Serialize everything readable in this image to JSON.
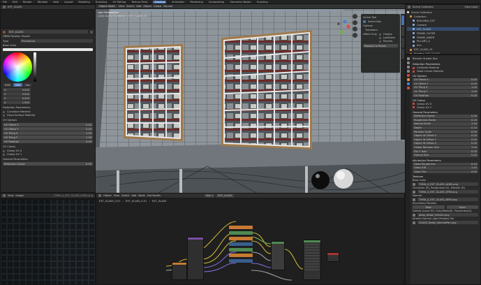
{
  "menubar": {
    "items": [
      "File",
      "Edit",
      "Render",
      "Window",
      "Help",
      "Layout",
      "Modeling",
      "Sculpting",
      "UV Editing",
      "Texture Paint",
      "Shading",
      "Animation",
      "Rendering",
      "Compositing",
      "Geometry Nodes",
      "Scripting"
    ]
  },
  "left_top": {
    "item": "EXT_GLASS"
  },
  "material": {
    "slot_name": "EXT_GLASS",
    "shader": "HBSN Parallax Shader",
    "type_label": "Type",
    "type_value": "Procedural",
    "color_label": "Base Color",
    "color_modes": [
      "RGB",
      "HSV",
      "Hex"
    ],
    "hsv": [
      {
        "k": "H",
        "v": "0.000"
      },
      {
        "k": "S",
        "v": "0.000"
      },
      {
        "k": "V",
        "v": "0.900"
      },
      {
        "k": "A",
        "v": "1.000"
      }
    ],
    "section_inputs": "Distortion Parameters",
    "checks": [
      "Curvature Material",
      "Flood Surface Material"
    ],
    "section_uv": "UV Options",
    "uv_fields": [
      {
        "label": "UV Offset X",
        "value": "0.00"
      },
      {
        "label": "UV Offset Y",
        "value": "0.00"
      },
      {
        "label": "UV Tiling X",
        "value": "1.00"
      },
      {
        "label": "UV Tiling Y",
        "value": "1.00"
      },
      {
        "label": "UV Rotation",
        "value": "0.00"
      }
    ],
    "section_clamp": "UV Clamp",
    "clamp_checks": [
      "Clamp UV X",
      "Clamp UV Y"
    ],
    "section_general": "General Parameters",
    "general_fields": [
      {
        "label": "Reflection Factor",
        "value": "0.50"
      }
    ]
  },
  "viewport": {
    "header_items": [
      "Object Mode",
      "View",
      "Select",
      "Add",
      "Object",
      "Global",
      "Normal"
    ],
    "title": "User Perspective",
    "subtitle": "(323) Scene Collection | EXT_GLASS_01",
    "npanel": {
      "header": "Active Tool",
      "select_box": "Select Box",
      "options": "Options",
      "transform": "Transform",
      "affect_only": "Affect Only",
      "affect_items": [
        "Origins",
        "Locations",
        "Parents"
      ],
      "replace": "Replace to Bones"
    }
  },
  "outliner": {
    "title": "Scene Collection",
    "view_layer": "View Layer",
    "items": [
      {
        "label": "Scene Collection",
        "indent": 0
      },
      {
        "label": "Collection",
        "indent": 1
      },
      {
        "label": "BUILDING_EXT",
        "indent": 2
      },
      {
        "label": "Camera",
        "indent": 2
      },
      {
        "label": "EXT_GLASS",
        "indent": 2
      },
      {
        "label": "FRAME_OUTER",
        "indent": 2
      },
      {
        "label": "FRAME_INNER",
        "indent": 2
      },
      {
        "label": "PILLARS_A",
        "indent": 2
      },
      {
        "label": "Sun",
        "indent": 2
      },
      {
        "label": "EXT_GLASS_01",
        "indent": 1
      },
      {
        "label": "Shaders_EXT_GLASS",
        "indent": 1
      }
    ]
  },
  "props": {
    "section_opts": "Blender Shader Box",
    "groups": [
      {
        "title": "Distortion Parameters",
        "rows": [
          {
            "check": true,
            "label": "Calibrate Material"
          },
          {
            "check": true,
            "label": "Head Cutout Material"
          }
        ]
      },
      {
        "title": "UV Options",
        "fields": [
          {
            "label": "UV Offset X",
            "value": "0.00"
          },
          {
            "label": "UV Offset Y",
            "value": "0.00"
          },
          {
            "label": "UV Tiling X",
            "value": "1.00"
          },
          {
            "label": "UV Tiling Y",
            "value": "1.00"
          },
          {
            "label": "UV Rotation",
            "value": "0.00"
          }
        ]
      },
      {
        "title": "UV Clamp",
        "rows": [
          {
            "check": true,
            "label": "Clamp UV X"
          },
          {
            "check": true,
            "label": "Clamp UV Y"
          }
        ]
      },
      {
        "title": "General Parameters",
        "fields": [
          {
            "label": "Reflection Factor",
            "value": "0.50"
          },
          {
            "label": "Roughness Factor",
            "value": "0.20"
          },
          {
            "label": "Normal Scale",
            "value": "1.00"
          },
          {
            "label": "Depth",
            "value": "0.10"
          },
          {
            "label": "Parallax Scale",
            "value": "0.05"
          },
          {
            "label": "Object W Offset X",
            "value": "0.00"
          },
          {
            "label": "Object W Offset Y",
            "value": "0.00"
          },
          {
            "label": "Object W Offset Z",
            "value": "0.00"
          },
          {
            "label": "Global Random Size",
            "value": "1.00"
          },
          {
            "label": "Flip Y Axis",
            "value": "0.00"
          },
          {
            "label": "Fresnel Size",
            "value": "0.50"
          }
        ]
      },
      {
        "title": "Attribution Parameters",
        "fields": [
          {
            "label": "Glass Roughness",
            "value": "0.10"
          },
          {
            "label": "Glass IOR",
            "value": "1.45"
          },
          {
            "label": "Glass Tint",
            "value": "0.00"
          }
        ]
      }
    ],
    "textures_title": "Textures",
    "textures": [
      {
        "label": "Base Color",
        "file": "TXMA_4_EXT_GLASS_ALBD.png"
      },
      {
        "label": "Occlusion (R), Roughness (G), Metallic (B)",
        "file": "TXMA_4_EXT_GLASS_ORM.png"
      },
      {
        "label": "Normal",
        "file": "TXMA_4_EXT_GLASS_NRM.png"
      },
      {
        "label": "Secondary Parallax",
        "file": ""
      },
      {
        "label": "Details (Local RG, Gray/Mask(B), Properties(A))",
        "file": "glass_detail_interior.png"
      },
      {
        "label": "Interior Normal (opt) Parallax Vol",
        "file": "GLASS_Detail_NormalPan.png"
      }
    ],
    "new_label": "New",
    "open_label": "Open"
  },
  "node_editor": {
    "header_items": [
      "Object",
      "View",
      "Select",
      "Add",
      "Node",
      "Use Nodes"
    ],
    "slot": "Slot 1",
    "material": "EXT_GLASS",
    "breadcrumbs": [
      "EXT_GLASS_0-01",
      "EXT_GLASS_0-01",
      "EXT_GLASS"
    ]
  },
  "image_editor": {
    "header_items": [
      "View",
      "Image"
    ],
    "image_name": "TXMA_4_EXT_GLASS_ALBD.png"
  },
  "colors": {
    "accent": "#4772b3",
    "sky": "#8fa2b2",
    "wall": "#8d9499",
    "frame": "#a07a4c",
    "noodle_yellow": "#c9b23a",
    "noodle_purple": "#7a6ad4",
    "noodle_grey": "#a0a0a0",
    "node_orange": "#c87a32",
    "node_green": "#4f8a52",
    "node_blue": "#3a5f8f"
  }
}
